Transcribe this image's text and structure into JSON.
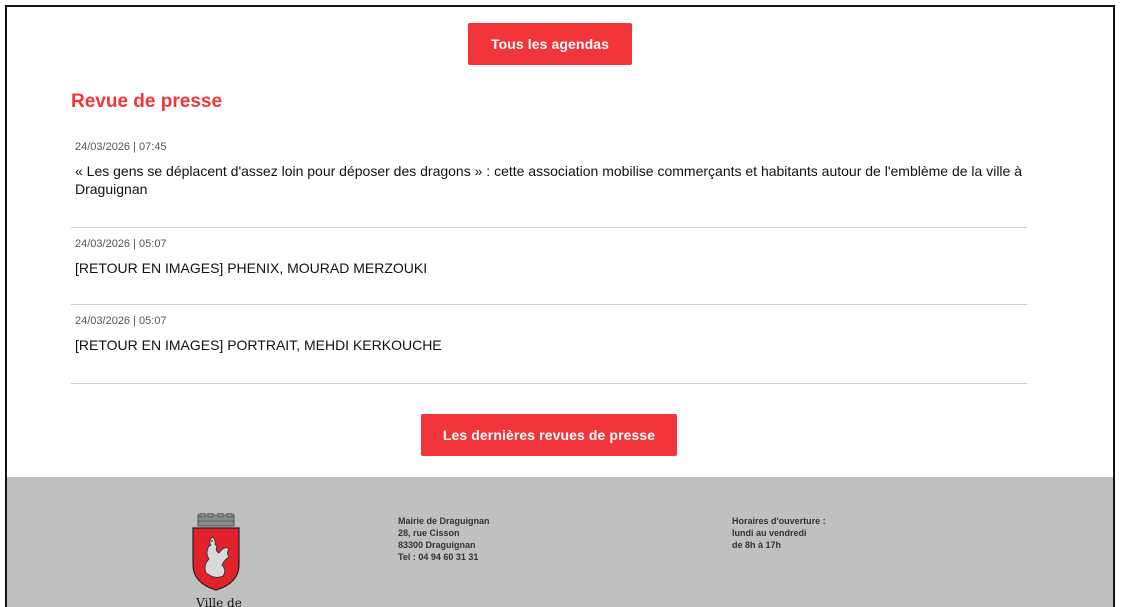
{
  "agendas_button": "Tous les agendas",
  "press": {
    "title": "Revue de presse",
    "items": [
      {
        "date": "24/03/2026 | 07:45",
        "title": "« Les gens se déplacent d'assez loin pour déposer des dragons » : cette association mobilise commerçants et habitants autour de l'emblème de la ville à Draguignan"
      },
      {
        "date": "24/03/2026 | 05:07",
        "title": "[RETOUR EN IMAGES] PHENIX, MOURAD MERZOUKI"
      },
      {
        "date": "24/03/2026 | 05:07",
        "title": "[RETOUR EN IMAGES] PORTRAIT, MEHDI KERKOUCHE"
      }
    ],
    "more_button": "Les dernières revues de presse"
  },
  "footer": {
    "logo_text": "Ville de Draguignan",
    "address": {
      "name": "Mairie de Draguignan",
      "street": "28, rue Cisson",
      "city": "83300 Draguignan",
      "phone": "Tel : 04 94 60 31 31"
    },
    "hours": {
      "label": "Horaires d'ouverture :",
      "days": "lundi au vendredi",
      "time": "de 8h à 17h"
    }
  },
  "colors": {
    "accent": "#f1353a",
    "footer_bg": "#c0c0c0"
  }
}
